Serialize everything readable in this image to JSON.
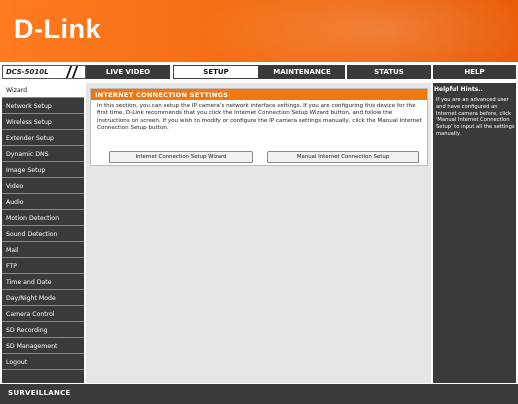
{
  "brand": {
    "logo_text": "D-Link",
    "model": "DCS-5010L",
    "accent_color": "#f07812",
    "dark_color": "#3a3a3a"
  },
  "nav": {
    "tabs": [
      {
        "label": "LIVE VIDEO"
      },
      {
        "label": "SETUP"
      },
      {
        "label": "MAINTENANCE"
      },
      {
        "label": "STATUS"
      },
      {
        "label": "HELP"
      }
    ]
  },
  "sidebar": {
    "items": [
      {
        "label": "Wizard"
      },
      {
        "label": "Network Setup"
      },
      {
        "label": "Wireless Setup"
      },
      {
        "label": "Extender Setup"
      },
      {
        "label": "Dynamic DNS"
      },
      {
        "label": "Image Setup"
      },
      {
        "label": "Video"
      },
      {
        "label": "Audio"
      },
      {
        "label": "Motion Detection"
      },
      {
        "label": "Sound Detection"
      },
      {
        "label": "Mail"
      },
      {
        "label": "FTP"
      },
      {
        "label": "Time and Date"
      },
      {
        "label": "Day/Night Mode"
      },
      {
        "label": "Camera Control"
      },
      {
        "label": "SD Recording"
      },
      {
        "label": "SD Management"
      },
      {
        "label": "Logout"
      }
    ]
  },
  "main": {
    "section_title": "INTERNET CONNECTION SETTINGS",
    "section_text": "In this section, you can setup the IP camera's network interface settings. If you are configuring this device for the first time, D-Link recommends that you click the Internet Connection Setup Wizard button, and follow the instructions on screen. If you wish to modify or configure the IP camera settings manually, click the Manual Internet Connection Setup button.",
    "buttons": {
      "wizard": "Internet Connection Setup Wizard",
      "manual": "Manual Internet Connection Setup"
    }
  },
  "help": {
    "title": "Helpful Hints..",
    "text": "If you are an advanced user and have configured an Internet camera before, click 'Manual Internet Connection Setup' to input all the settings manually."
  },
  "footer": {
    "label": "SURVEILLANCE"
  }
}
